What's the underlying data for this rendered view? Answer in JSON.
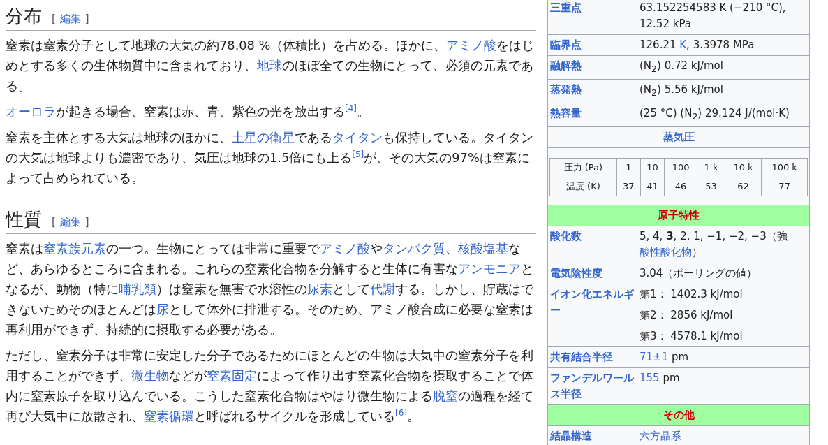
{
  "sections": [
    {
      "heading": "分布",
      "edit_open": "[",
      "edit_link": "編集",
      "edit_close": "]",
      "paragraphs": [
        {
          "segments": [
            {
              "kind": "plain",
              "text": "窒素は窒素分子として地球の大気の約78.08 %（体積比）を占める。ほかに、"
            },
            {
              "kind": "link",
              "text": "アミノ酸"
            },
            {
              "kind": "plain",
              "text": "をはじめとする多くの生体物質中に含まれており、"
            },
            {
              "kind": "link",
              "text": "地球"
            },
            {
              "kind": "plain",
              "text": "のほぼ全ての生物にとって、必須の元素である。"
            }
          ]
        },
        {
          "segments": [
            {
              "kind": "link",
              "text": "オーロラ"
            },
            {
              "kind": "plain",
              "text": "が起きる場合、窒素は赤、青、紫色の光を放出する"
            },
            {
              "kind": "ref",
              "text": "[4]"
            },
            {
              "kind": "plain",
              "text": "。"
            }
          ]
        },
        {
          "segments": [
            {
              "kind": "plain",
              "text": "窒素を主体とする大気は地球のほかに、"
            },
            {
              "kind": "link",
              "text": "土星の衛星"
            },
            {
              "kind": "plain",
              "text": "である"
            },
            {
              "kind": "link",
              "text": "タイタン"
            },
            {
              "kind": "plain",
              "text": "も保持している。タイタンの大気は地球よりも濃密であり、気圧は地球の1.5倍にも上る"
            },
            {
              "kind": "ref",
              "text": "[5]"
            },
            {
              "kind": "plain",
              "text": "が、その大気の97%は窒素によって占められている。"
            }
          ]
        }
      ]
    },
    {
      "heading": "性質",
      "edit_open": "[",
      "edit_link": "編集",
      "edit_close": "]",
      "paragraphs": [
        {
          "segments": [
            {
              "kind": "plain",
              "text": "窒素は"
            },
            {
              "kind": "link",
              "text": "窒素族元素"
            },
            {
              "kind": "plain",
              "text": "の一つ。生物にとっては非常に重要で"
            },
            {
              "kind": "link",
              "text": "アミノ酸"
            },
            {
              "kind": "plain",
              "text": "や"
            },
            {
              "kind": "link",
              "text": "タンパク質"
            },
            {
              "kind": "plain",
              "text": "、"
            },
            {
              "kind": "link",
              "text": "核酸塩基"
            },
            {
              "kind": "plain",
              "text": "など、あらゆるところに含まれる。これらの窒素化合物を分解すると生体に有害な"
            },
            {
              "kind": "link",
              "text": "アンモニア"
            },
            {
              "kind": "plain",
              "text": "となるが、動物（特に"
            },
            {
              "kind": "link",
              "text": "哺乳類"
            },
            {
              "kind": "plain",
              "text": "）は窒素を無害で水溶性の"
            },
            {
              "kind": "link",
              "text": "尿素"
            },
            {
              "kind": "plain",
              "text": "として"
            },
            {
              "kind": "link",
              "text": "代謝"
            },
            {
              "kind": "plain",
              "text": "する。しかし、貯蔵はできないためそのほとんどは"
            },
            {
              "kind": "link",
              "text": "尿"
            },
            {
              "kind": "plain",
              "text": "として体外に排泄する。そのため、アミノ酸合成に必要な窒素は再利用ができず、持続的に摂取する必要がある。"
            }
          ]
        },
        {
          "segments": [
            {
              "kind": "plain",
              "text": "ただし、窒素分子は非常に安定した分子であるためにほとんどの生物は大気中の窒素分子を利用することができず、"
            },
            {
              "kind": "link",
              "text": "微生物"
            },
            {
              "kind": "plain",
              "text": "などが"
            },
            {
              "kind": "link",
              "text": "窒素固定"
            },
            {
              "kind": "plain",
              "text": "によって作り出す窒素化合物を摂取することで体内に窒素原子を取り込んでいる。こうした窒素化合物はやはり微生物による"
            },
            {
              "kind": "link",
              "text": "脱窒"
            },
            {
              "kind": "plain",
              "text": "の過程を経て再び大気中に放散され、"
            },
            {
              "kind": "link",
              "text": "窒素循環"
            },
            {
              "kind": "plain",
              "text": "と呼ばれるサイクルを形成している"
            },
            {
              "kind": "ref",
              "text": "[6]"
            },
            {
              "kind": "plain",
              "text": "。"
            }
          ]
        }
      ]
    }
  ],
  "infobox": {
    "rows": [
      {
        "kind": "property",
        "label": "三重点",
        "values": [
          [
            {
              "kind": "plain",
              "text": "63.152254583 K (−210 °C), 12.52 kPa"
            }
          ]
        ]
      },
      {
        "kind": "property",
        "label": "臨界点",
        "values": [
          [
            {
              "kind": "plain",
              "text": "126.21 "
            },
            {
              "kind": "link",
              "text": "K"
            },
            {
              "kind": "plain",
              "text": ", 3.3978 MPa"
            }
          ]
        ]
      },
      {
        "kind": "property",
        "label": "融解熱",
        "values": [
          [
            {
              "kind": "plain",
              "text": "(N$_{2}$) 0.72 kJ/mol"
            }
          ]
        ]
      },
      {
        "kind": "property",
        "label": "蒸発熱",
        "values": [
          [
            {
              "kind": "plain",
              "text": "(N$_{2}$) 5.56 kJ/mol"
            }
          ]
        ]
      },
      {
        "kind": "property",
        "label": "熱容量",
        "values": [
          [
            {
              "kind": "plain",
              "text": "(25 °C) (N$_{2}$) 29.124 J/(mol·K)"
            }
          ]
        ]
      },
      {
        "kind": "subheading",
        "label": "蒸気圧"
      },
      {
        "kind": "vapor_table",
        "table": [
          [
            "圧力 (Pa)",
            "1",
            "10",
            "100",
            "1 k",
            "10 k",
            "100 k"
          ],
          [
            "温度 (K)",
            "37",
            "41",
            "46",
            "53",
            "62",
            "77"
          ]
        ]
      },
      {
        "kind": "group_heading",
        "label": "原子特性"
      },
      {
        "kind": "property",
        "label": "酸化数",
        "values": [
          [
            {
              "kind": "plain",
              "text": "5, 4, **3**, 2, 1, −1, −2, −3（強"
            },
            {
              "kind": "link",
              "text": "酸性酸化物"
            },
            {
              "kind": "plain",
              "text": "）"
            }
          ]
        ]
      },
      {
        "kind": "property",
        "label": "電気陰性度",
        "values": [
          [
            {
              "kind": "plain",
              "text": "3.04（ポーリングの値）"
            }
          ]
        ]
      },
      {
        "kind": "property",
        "label": "イオン化エネルギー",
        "values": [
          [
            {
              "kind": "plain",
              "text": "第1：  1402.3 kJ/mol"
            }
          ],
          [
            {
              "kind": "plain",
              "text": "第2：  2856 kJ/mol"
            }
          ],
          [
            {
              "kind": "plain",
              "text": "第3：  4578.1 kJ/mol"
            }
          ]
        ]
      },
      {
        "kind": "property",
        "label": "共有結合半径",
        "values": [
          [
            {
              "kind": "link",
              "text": "71±1"
            },
            {
              "kind": "plain",
              "text": " pm"
            }
          ]
        ]
      },
      {
        "kind": "property",
        "label": "ファンデルワールス半径",
        "values": [
          [
            {
              "kind": "link",
              "text": "155"
            },
            {
              "kind": "plain",
              "text": " pm"
            }
          ]
        ]
      },
      {
        "kind": "group_heading",
        "label": "その他"
      },
      {
        "kind": "property",
        "label": "結晶構造",
        "values": [
          [
            {
              "kind": "link",
              "text": "六方晶系"
            }
          ]
        ]
      }
    ]
  }
}
